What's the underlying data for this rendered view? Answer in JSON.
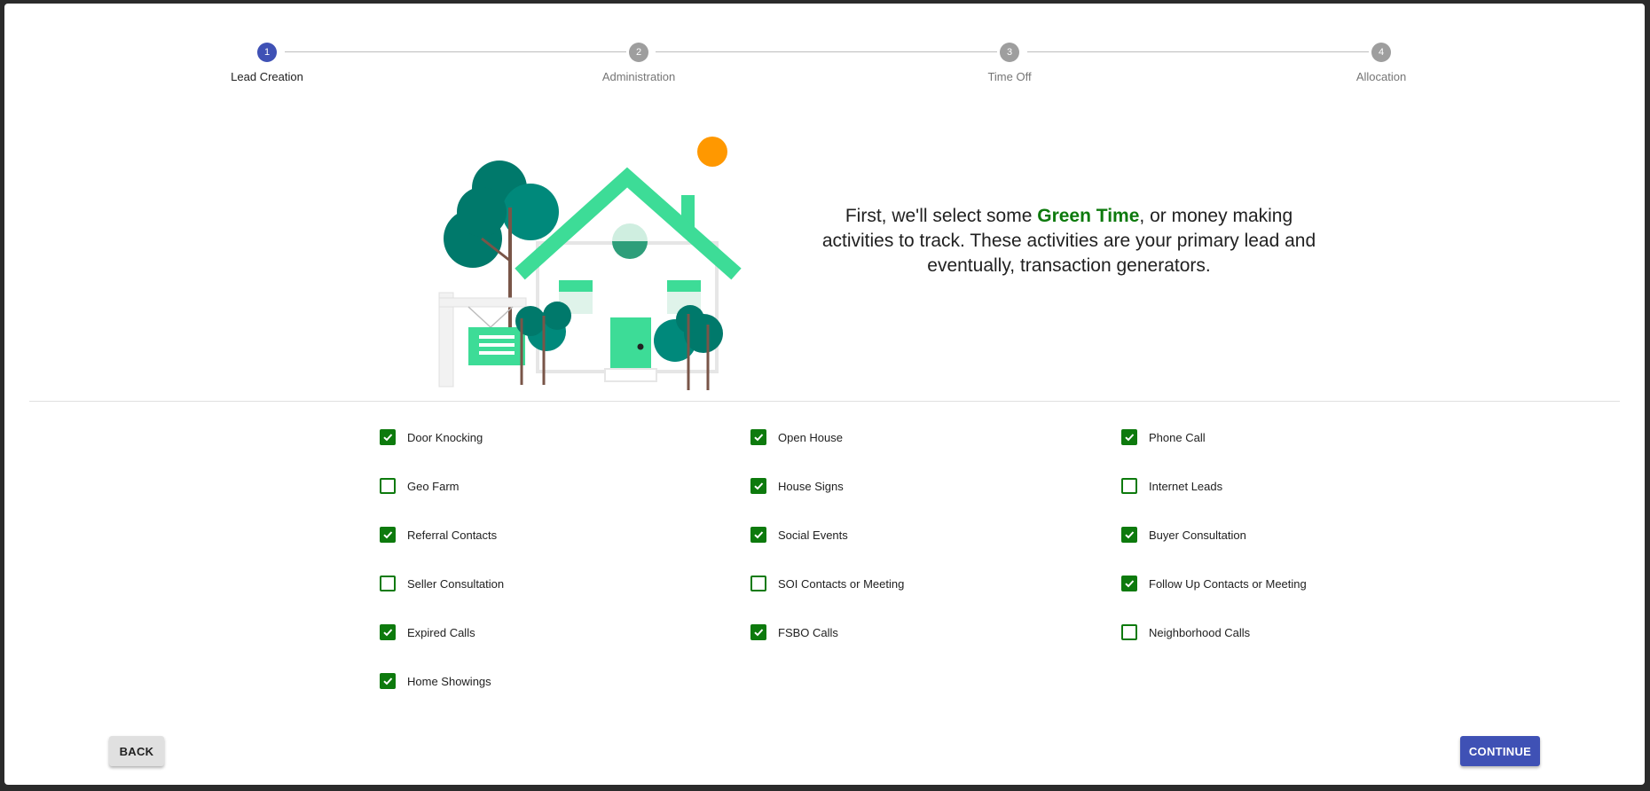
{
  "stepper": {
    "steps": [
      {
        "number": "1",
        "label": "Lead Creation"
      },
      {
        "number": "2",
        "label": "Administration"
      },
      {
        "number": "3",
        "label": "Time Off"
      },
      {
        "number": "4",
        "label": "Allocation"
      }
    ],
    "active_step": 1
  },
  "hero": {
    "text_before": "First, we'll select some ",
    "highlight": "Green Time",
    "text_after": ", or money making activities to track. These activities are your primary lead and eventually, transaction generators.",
    "illustration": "house-illustration"
  },
  "options": [
    {
      "label": "Door Knocking",
      "checked": true
    },
    {
      "label": "Open House",
      "checked": true
    },
    {
      "label": "Phone Call",
      "checked": true
    },
    {
      "label": "Geo Farm",
      "checked": false
    },
    {
      "label": "House Signs",
      "checked": true
    },
    {
      "label": "Internet Leads",
      "checked": false
    },
    {
      "label": "Referral Contacts",
      "checked": true
    },
    {
      "label": "Social Events",
      "checked": true
    },
    {
      "label": "Buyer Consultation",
      "checked": true
    },
    {
      "label": "Seller Consultation",
      "checked": false
    },
    {
      "label": "SOI Contacts or Meeting",
      "checked": false
    },
    {
      "label": "Follow Up Contacts or Meeting",
      "checked": true
    },
    {
      "label": "Expired Calls",
      "checked": true
    },
    {
      "label": "FSBO Calls",
      "checked": true
    },
    {
      "label": "Neighborhood Calls",
      "checked": false
    },
    {
      "label": "Home Showings",
      "checked": true
    }
  ],
  "buttons": {
    "back_label": "BACK",
    "continue_label": "CONTINUE"
  },
  "colors": {
    "primary": "#3f51b5",
    "green": "#0d7a0d",
    "inactive_step": "#9e9e9e"
  }
}
